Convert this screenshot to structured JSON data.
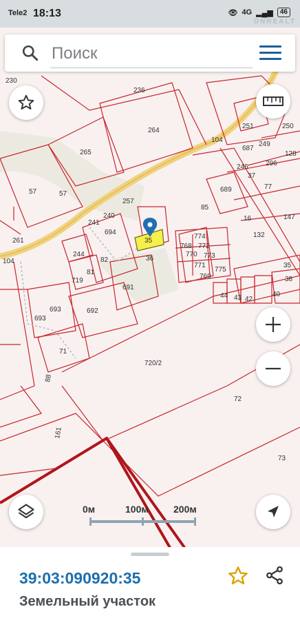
{
  "status_bar": {
    "carrier": "Tele2",
    "time": "18:13",
    "network": "4G",
    "battery": "46"
  },
  "watermark": "ONREALT",
  "search": {
    "placeholder": "Поиск"
  },
  "map": {
    "parcel_labels": [
      "230",
      "236",
      "264",
      "265",
      "57",
      "57",
      "261",
      "104",
      "104",
      "257",
      "240",
      "241",
      "694",
      "244",
      "81",
      "82",
      "719",
      "36",
      "768",
      "774",
      "770",
      "772",
      "771",
      "773",
      "769",
      "775",
      "689",
      "85",
      "691",
      "692",
      "693",
      "693",
      "71",
      "720/2",
      "72",
      "73",
      "161",
      "88",
      "44",
      "43",
      "42",
      "40",
      "38",
      "16",
      "132",
      "147",
      "77",
      "37",
      "296",
      "246",
      "687",
      "249",
      "251",
      "250",
      "128",
      "35"
    ]
  },
  "scale": {
    "labels": [
      "0м",
      "100м",
      "200м"
    ]
  },
  "selected_parcel_label": "35",
  "parcel": {
    "cadastral_number": "39:03:090920:35",
    "type": "Земельный участок"
  },
  "colors": {
    "accent": "#1b6fae",
    "boundary": "#c8262d",
    "road": "#f2d27a",
    "selected": "#f5f04a",
    "star": "#d9a400"
  }
}
